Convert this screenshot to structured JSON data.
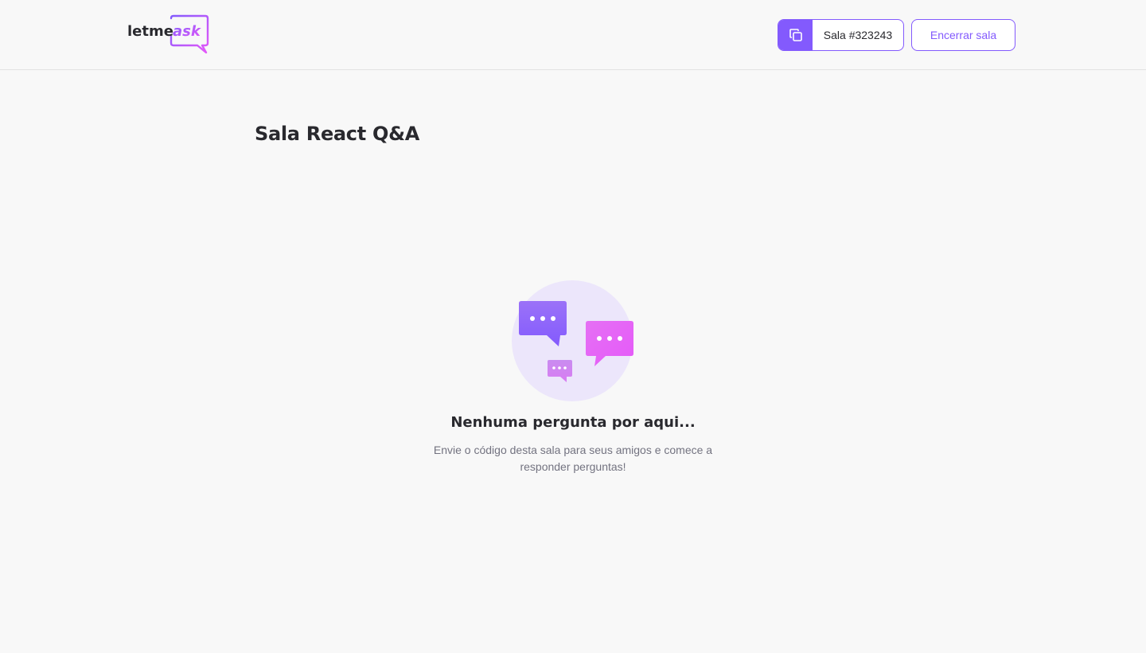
{
  "header": {
    "logo": {
      "text_letme": "letme",
      "text_ask": "ask"
    },
    "room_code": {
      "label": "Sala #323243",
      "icon": "copy-icon"
    },
    "close_room_label": "Encerrar sala"
  },
  "main": {
    "title": "Sala React Q&A",
    "empty_state": {
      "icon": "chat-bubbles-illustration",
      "title": "Nenhuma pergunta por aqui...",
      "description": "Envie o código desta sala para seus amigos e comece a responder perguntas!"
    }
  },
  "colors": {
    "accent": "#835afd",
    "pink": "#e559f9",
    "background": "#f8f8f8",
    "text": "#29292e",
    "muted": "#737380"
  }
}
